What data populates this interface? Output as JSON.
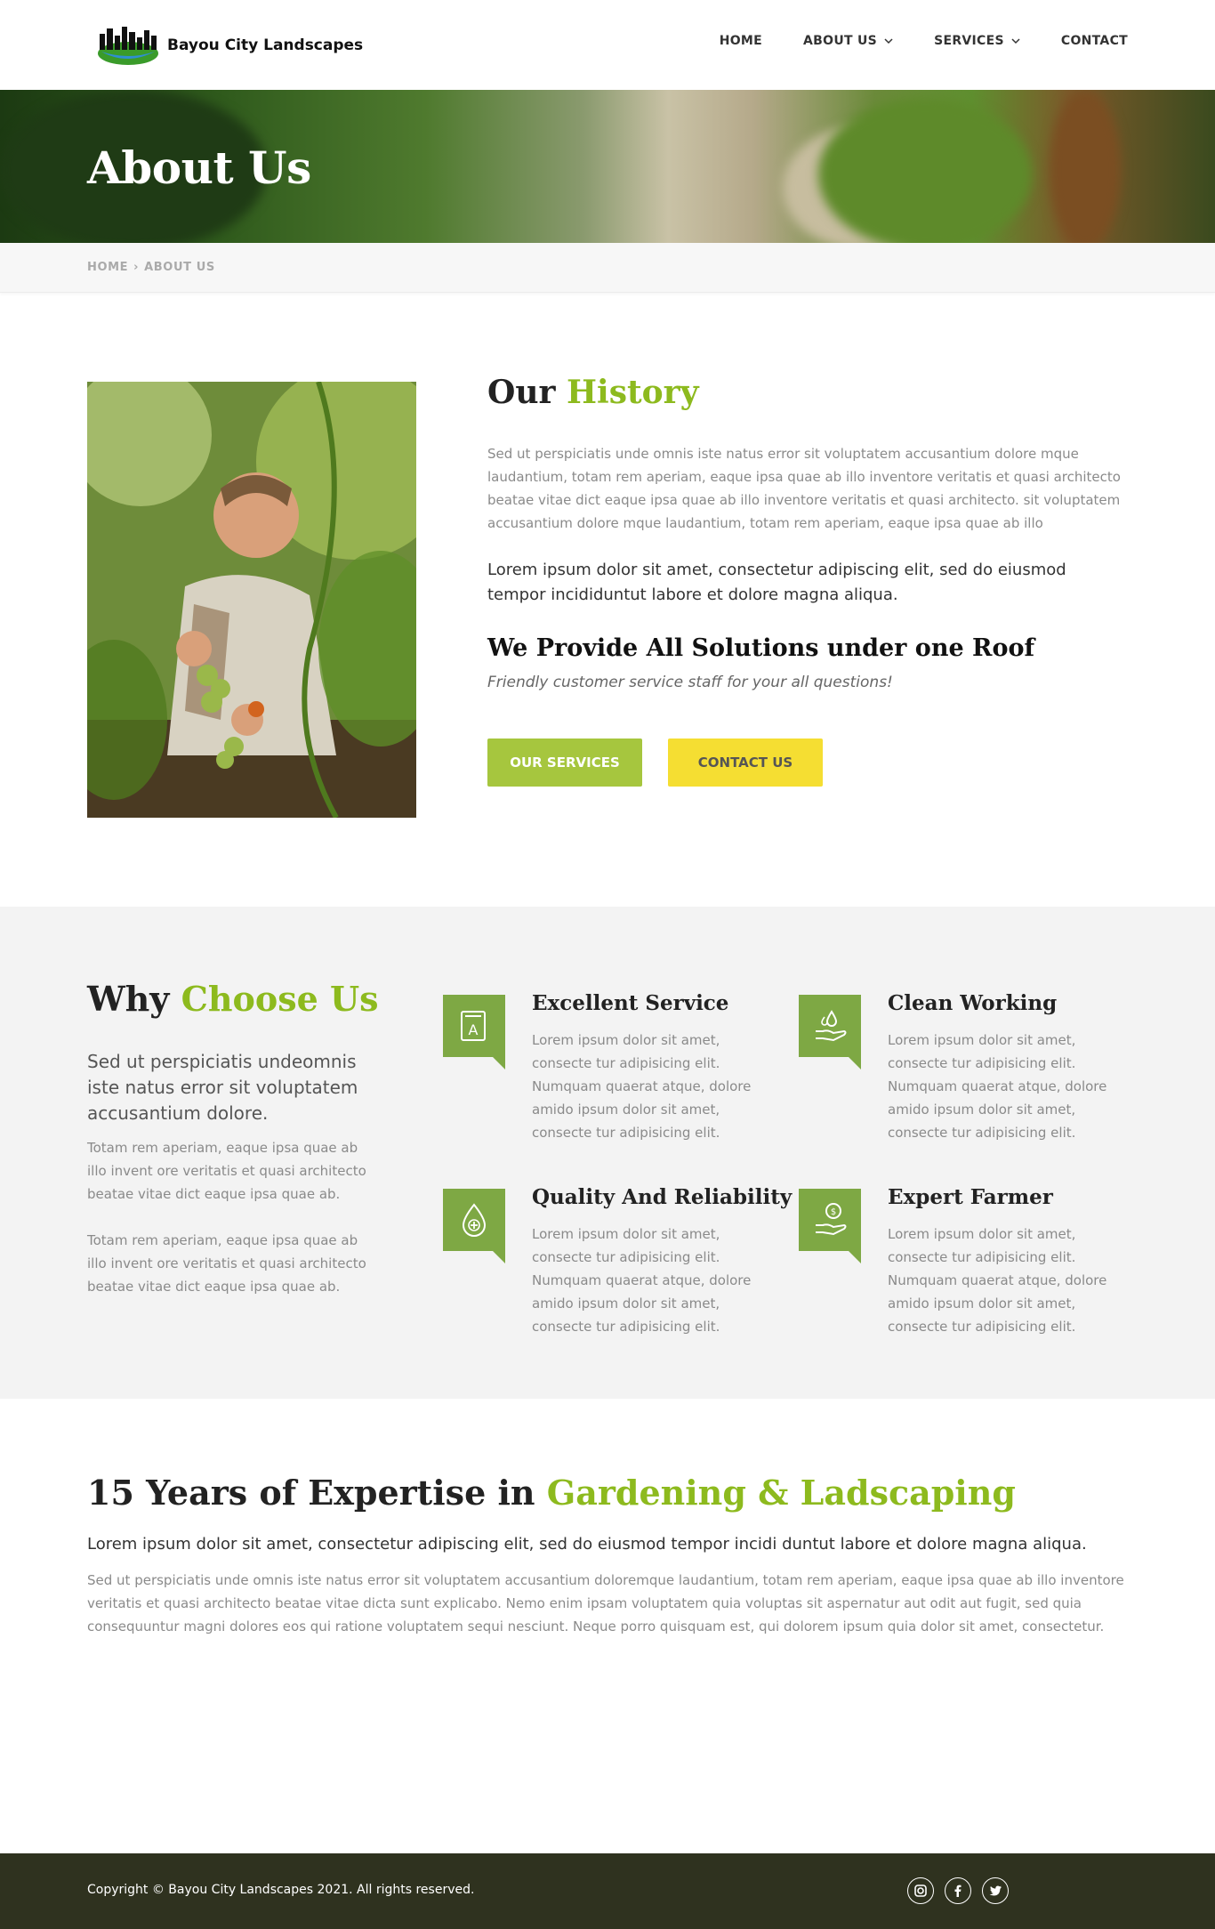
{
  "brand": {
    "name": "Bayou City Landscapes"
  },
  "nav": {
    "items": [
      {
        "label": "HOME"
      },
      {
        "label": "ABOUT US"
      },
      {
        "label": "SERVICES"
      },
      {
        "label": "CONTACT"
      }
    ]
  },
  "banner": {
    "title": "About Us"
  },
  "breadcrumb": {
    "home": "HOME",
    "sep": "›",
    "current": "ABOUT US"
  },
  "history": {
    "title_plain": "Our",
    "title_accent": "History",
    "para1": "Sed ut perspiciatis unde omnis iste natus error sit voluptatem accusantium dolore mque laudantium, totam rem aperiam, eaque ipsa quae ab illo inventore veritatis et quasi architecto beatae vitae dict eaque ipsa quae ab illo inventore veritatis et quasi architecto. sit voluptatem accusantium dolore mque laudantium, totam rem aperiam, eaque ipsa quae ab illo",
    "para2": "Lorem ipsum dolor sit amet, consectetur adipiscing elit, sed do eiusmod tempor incididuntut labore et dolore magna aliqua.",
    "subtitle": "We Provide All Solutions under one Roof",
    "tagline": "Friendly customer service staff for your all questions!",
    "btn_services": "OUR SERVICES",
    "btn_contact": "CONTACT US"
  },
  "why": {
    "title_plain": "Why",
    "title_accent": "Choose Us",
    "lead": "Sed ut perspiciatis undeomnis iste natus error sit voluptatem accusantium dolore.",
    "para1": "Totam rem aperiam, eaque ipsa quae ab illo invent ore veritatis et quasi architecto beatae vitae dict eaque ipsa quae ab.",
    "para2": "Totam rem aperiam, eaque ipsa quae ab illo invent ore veritatis et quasi architecto beatae vitae dict eaque ipsa quae ab.",
    "features": [
      {
        "title": "Excellent Service",
        "text": "Lorem ipsum dolor sit amet, consecte tur adipisicing elit. Numquam quaerat atque, dolore amido ipsum dolor sit amet, consecte tur adipisicing elit.",
        "icon": "book-icon"
      },
      {
        "title": "Clean Working",
        "text": "Lorem ipsum dolor sit amet, consecte tur adipisicing elit. Numquam quaerat atque, dolore amido ipsum dolor sit amet, consecte tur adipisicing elit.",
        "icon": "water-hand-icon"
      },
      {
        "title": "Quality And Reliability",
        "text": "Lorem ipsum dolor sit amet, consecte tur adipisicing elit. Numquam quaerat atque, dolore amido ipsum dolor sit amet, consecte tur adipisicing elit.",
        "icon": "drop-plus-icon"
      },
      {
        "title": "Expert Farmer",
        "text": "Lorem ipsum dolor sit amet, consecte tur adipisicing elit. Numquam quaerat atque, dolore amido ipsum dolor sit amet, consecte tur adipisicing elit.",
        "icon": "money-hand-icon"
      }
    ]
  },
  "expertise": {
    "title_plain": "15 Years of Expertise in",
    "title_accent": "Gardening & Ladscaping",
    "lead": "Lorem ipsum dolor sit amet, consectetur adipiscing elit, sed do eiusmod tempor incidi duntut labore et dolore magna aliqua.",
    "para": "Sed ut perspiciatis unde omnis iste natus error sit voluptatem accusantium doloremque laudantium, totam rem aperiam, eaque ipsa quae ab illo inventore veritatis et quasi architecto beatae vitae dicta sunt explicabo. Nemo enim ipsam voluptatem quia voluptas sit aspernatur aut odit aut fugit, sed quia consequuntur magni dolores eos qui ratione voluptatem sequi nesciunt. Neque porro quisquam est, qui dolorem ipsum quia dolor sit amet, consectetur."
  },
  "footer": {
    "copyright": "Copyright © Bayou City Landscapes 2021. All rights reserved.",
    "social": [
      "instagram-icon",
      "facebook-icon",
      "twitter-icon"
    ]
  },
  "colors": {
    "accent": "#8dba1e",
    "button_green": "#a6c63e",
    "button_yellow": "#f5de32",
    "icon_bg": "#7ea844",
    "footer_bg": "#2f321f"
  }
}
